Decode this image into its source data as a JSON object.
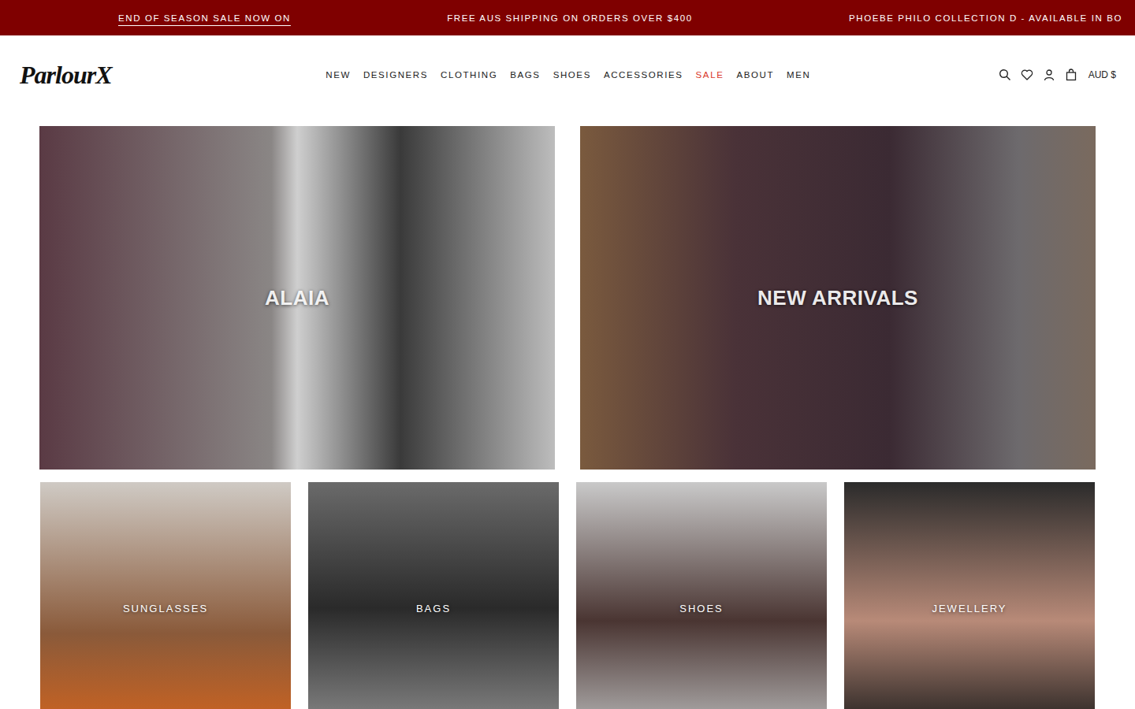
{
  "announcement_bar": {
    "messages": [
      {
        "text": "END OF SEASON SALE NOW ON",
        "link": true
      },
      {
        "text": "FREE AUS SHIPPING ON ORDERS OVER $400",
        "link": false
      },
      {
        "text": "PHOEBE PHILO COLLECTION D - AVAILABLE IN BO",
        "link": false
      }
    ]
  },
  "header": {
    "logo": "ParlourX",
    "currency": "AUD $",
    "nav": [
      {
        "label": "NEW",
        "color": "#222222"
      },
      {
        "label": "DESIGNERS",
        "color": "#222222"
      },
      {
        "label": "CLOTHING",
        "color": "#222222"
      },
      {
        "label": "BAGS",
        "color": "#222222"
      },
      {
        "label": "SHOES",
        "color": "#222222"
      },
      {
        "label": "ACCESSORIES",
        "color": "#222222"
      },
      {
        "label": "SALE",
        "color": "#d9382b"
      },
      {
        "label": "ABOUT",
        "color": "#222222"
      },
      {
        "label": "MEN",
        "color": "#222222"
      }
    ]
  },
  "hero_tiles": [
    {
      "label": "ALAIA"
    },
    {
      "label": "NEW ARRIVALS"
    }
  ],
  "category_tiles": [
    {
      "label": "SUNGLASSES"
    },
    {
      "label": "BAGS"
    },
    {
      "label": "SHOES"
    },
    {
      "label": "JEWELLERY"
    }
  ]
}
